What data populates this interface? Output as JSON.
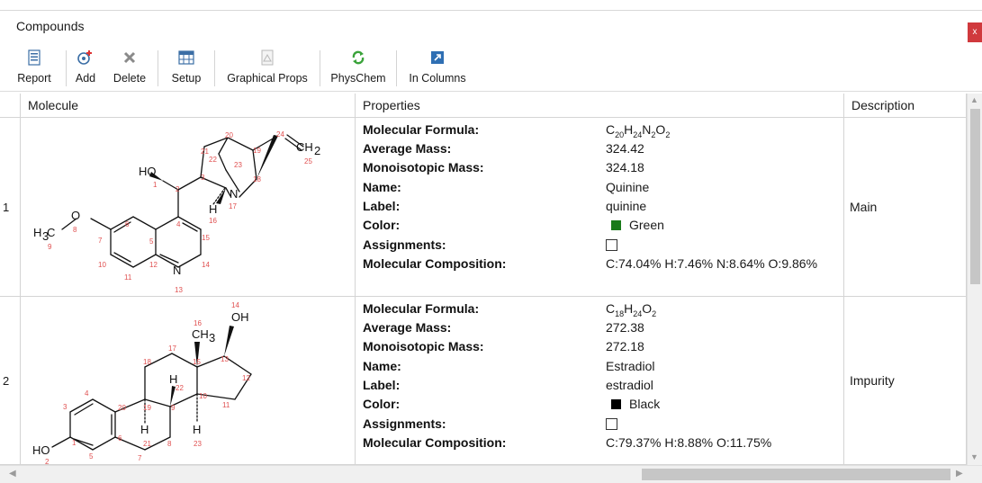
{
  "window": {
    "title": "Compounds",
    "close_label": "x"
  },
  "toolbar": {
    "buttons": [
      {
        "label": "Report",
        "icon": "report-icon"
      },
      {
        "label": "Add",
        "icon": "add-icon"
      },
      {
        "label": "Delete",
        "icon": "delete-icon"
      },
      {
        "label": "Setup",
        "icon": "setup-icon"
      },
      {
        "label": "Graphical Props",
        "icon": "graphical-props-icon"
      },
      {
        "label": "PhysChem",
        "icon": "physchem-icon"
      },
      {
        "label": "In Columns",
        "icon": "in-columns-icon"
      }
    ]
  },
  "table": {
    "columns": [
      "Molecule",
      "Properties",
      "Description"
    ],
    "rows": [
      {
        "index": "1",
        "properties": [
          {
            "key": "Molecular Formula:",
            "value": "C20H24N2O2"
          },
          {
            "key": "Average Mass:",
            "value": "324.42"
          },
          {
            "key": "Monoisotopic Mass:",
            "value": "324.18"
          },
          {
            "key": "Name:",
            "value": "Quinine"
          },
          {
            "key": "Label:",
            "value": "quinine"
          },
          {
            "key": "Color:",
            "value": "Green",
            "swatch": "#1a7a1a"
          },
          {
            "key": "Assignments:",
            "value": ""
          },
          {
            "key": "Molecular Composition:",
            "value": "C:74.04% H:7.46% N:8.64% O:9.86%"
          }
        ],
        "description": "Main"
      },
      {
        "index": "2",
        "properties": [
          {
            "key": "Molecular Formula:",
            "value": "C18H24O2"
          },
          {
            "key": "Average Mass:",
            "value": "272.38"
          },
          {
            "key": "Monoisotopic Mass:",
            "value": "272.18"
          },
          {
            "key": "Name:",
            "value": "Estradiol"
          },
          {
            "key": "Label:",
            "value": "estradiol"
          },
          {
            "key": "Color:",
            "value": "Black",
            "swatch": "#000000"
          },
          {
            "key": "Assignments:",
            "value": ""
          },
          {
            "key": "Molecular Composition:",
            "value": "C:79.37% H:8.88% O:11.75%"
          }
        ],
        "description": "Impurity"
      }
    ]
  },
  "molecules": {
    "quinine_atoms": {
      "ho": "HO",
      "ch2": "CH",
      "ch2_sub": "2",
      "n17": "N",
      "h16": "H",
      "o8": "O",
      "h3c": "H",
      "h3c_sub": "3",
      "h3c_c": "C",
      "n13": "N",
      "n1": "1",
      "n2": "2",
      "n3": "3",
      "n4": "4",
      "n5": "5",
      "n6": "6",
      "n7": "7",
      "n8": "8",
      "n9": "9",
      "n10": "10",
      "n11": "11",
      "n12": "12",
      "n13l": "13",
      "n14": "14",
      "n15": "15",
      "n16": "16",
      "n17l": "17",
      "n18": "18",
      "n19": "19",
      "n20": "20",
      "n21": "21",
      "n22": "22",
      "n23": "23",
      "n24": "24",
      "n25": "25"
    },
    "estradiol_atoms": {
      "oh": "OH",
      "ch3": "CH",
      "ch3_sub": "3",
      "h22": "H",
      "h21": "H",
      "h23": "H",
      "ho": "HO",
      "n1": "1",
      "n2": "2",
      "n3": "3",
      "n4": "4",
      "n5": "5",
      "n6": "6",
      "n7": "7",
      "n8": "8",
      "n9": "9",
      "n10": "10",
      "n11": "11",
      "n12": "12",
      "n13": "13",
      "n14": "14",
      "n15": "15",
      "n16": "16",
      "n17": "17",
      "n18": "18",
      "n19": "19",
      "n20": "20",
      "n21": "21",
      "n22": "22",
      "n23": "23"
    }
  },
  "colors": {
    "close_button": "#d0393d",
    "atom_number": "#e05050",
    "green_swatch": "#1a7a1a",
    "physchem_icon": "#3aa33a",
    "in_columns_icon": "#2f6fb3"
  }
}
